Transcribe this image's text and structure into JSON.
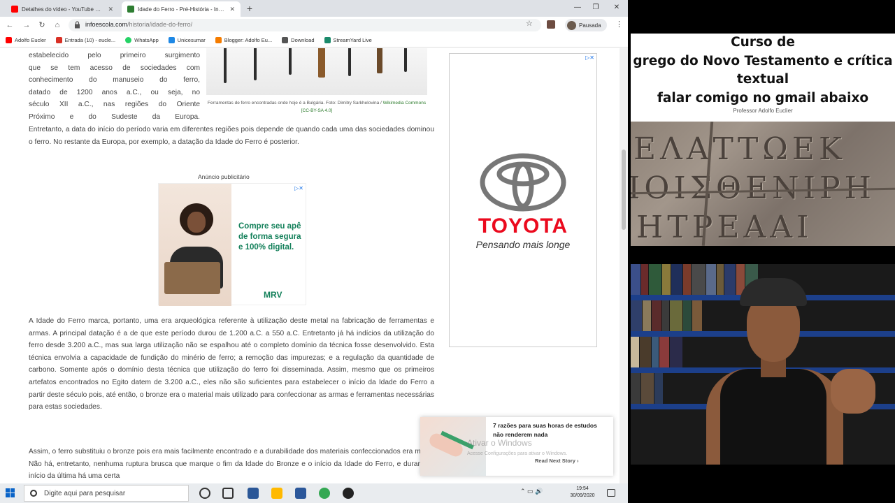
{
  "browser": {
    "tabs": [
      {
        "label": "Detalhes do vídeo - YouTube Studio",
        "active": false,
        "favicon_color": "#ff0000"
      },
      {
        "label": "Idade do Ferro - Pré-História - InfoEscola",
        "active": true,
        "favicon_color": "#2e7d32"
      }
    ],
    "url_host": "infoescola.com",
    "url_path": "/historia/idade-do-ferro/",
    "profile_label": "Pausada",
    "bookmarks": [
      {
        "label": "Adolfo Eucler",
        "color": "#ff0000"
      },
      {
        "label": "Entrada (10) - eucle...",
        "color": "#d93025"
      },
      {
        "label": "WhatsApp",
        "color": "#25d366"
      },
      {
        "label": "Unicesumar",
        "color": "#1e88e5"
      },
      {
        "label": "Blogger: Adolfo Eu...",
        "color": "#f57c00"
      },
      {
        "label": "Download",
        "color": "#555555"
      },
      {
        "label": "StreamYard Live",
        "color": "#1b8a6b"
      }
    ]
  },
  "article": {
    "para0_lines": [
      "estabelecido pelo primeiro surgimento",
      "que se tem acesso de sociedades com",
      "conhecimento do manuseio do ferro,",
      "datado de 1200 anos a.C., ou seja, no",
      "século XII a.C., nas regiões do Oriente",
      "Próximo e do Sudeste da Europa."
    ],
    "para1": "Entretanto, a data do início do período varia em diferentes regiões pois depende de quando cada uma das sociedades dominou o ferro. No restante da Europa, por exemplo, a datação da Idade do Ferro é posterior.",
    "image_caption": "Ferramentas de ferro encontradas onde hoje é a Bulgária. Foto: Dimitry Sarkhelovina / ",
    "caption_link": "Wikimedia Commons",
    "caption_license": "[CC-BY-SA 4.0]",
    "ad_label": "Anúncio publicitário",
    "para2": "A Idade do Ferro marca, portanto, uma era arqueológica referente à utilização deste metal na fabricação de ferramentas e armas. A principal datação é a de que este período durou de 1.200 a.C. a 550 a.C. Entretanto já há indícios da utilização do ferro desde 3.200 a.C., mas sua larga utilização não se espalhou até o completo domínio da técnica fosse desenvolvido. Esta técnica envolvia a capacidade de fundição do minério de ferro; a remoção das impurezas; e a regulação da quantidade de carbono. Somente após o domínio desta técnica que utilização do ferro foi disseminada. Assim, mesmo que os primeiros artefatos encontrados no Egito datem de 3.200 a.C., eles não são suficientes para estabelecer o início da Idade do Ferro a partir deste século pois, até então, o bronze era o material mais utilizado para confeccionar as armas e ferramentas necessárias para estas sociedades.",
    "para3": "Assim, o ferro substituiu o bronze pois era mais facilmente encontrado e a durabilidade dos materiais confeccionados era maior. Não há, entretanto, nenhuma ruptura brusca que marque o fim da Idade do Bronze e o início da Idade do Ferro, e durante o início da última há uma certa"
  },
  "ads": {
    "mrv_text": "Compre seu apê de forma segura e 100% digital.",
    "mrv_logo": "MRV",
    "toyota_brand": "TOYOTA",
    "toyota_slogan": "Pensando mais longe",
    "close_glyph": "▷✕"
  },
  "popup": {
    "title": "7 razões para suas horas de estudos não renderem nada",
    "link": "Read Next Story ›"
  },
  "watermark": {
    "line1": "Ativar o Windows",
    "line2": "Acesse Configurações para ativar o Windows."
  },
  "taskbar": {
    "search_placeholder": "Digite aqui para pesquisar",
    "time": "19:54",
    "date": "30/09/2020",
    "tray_glyphs": "⌃ ▭ 🔊"
  },
  "overlay": {
    "title_lines": [
      "Curso de",
      "grego do Novo Testamento e crítica",
      "textual",
      "falar comigo no gmail abaixo"
    ],
    "author": "Professor Adolfo Euclier",
    "inscription_lines": [
      "ΕΛΑΤΤΩΕΚ",
      "ΙΟΙΣΘΕΝΙΡΗ",
      "ΗΤΡΕΑΑΙ"
    ]
  },
  "colors": {
    "accent_green": "#13805a",
    "toyota_red": "#eb0a1e",
    "shelf_blue": "#1c3f8a"
  }
}
